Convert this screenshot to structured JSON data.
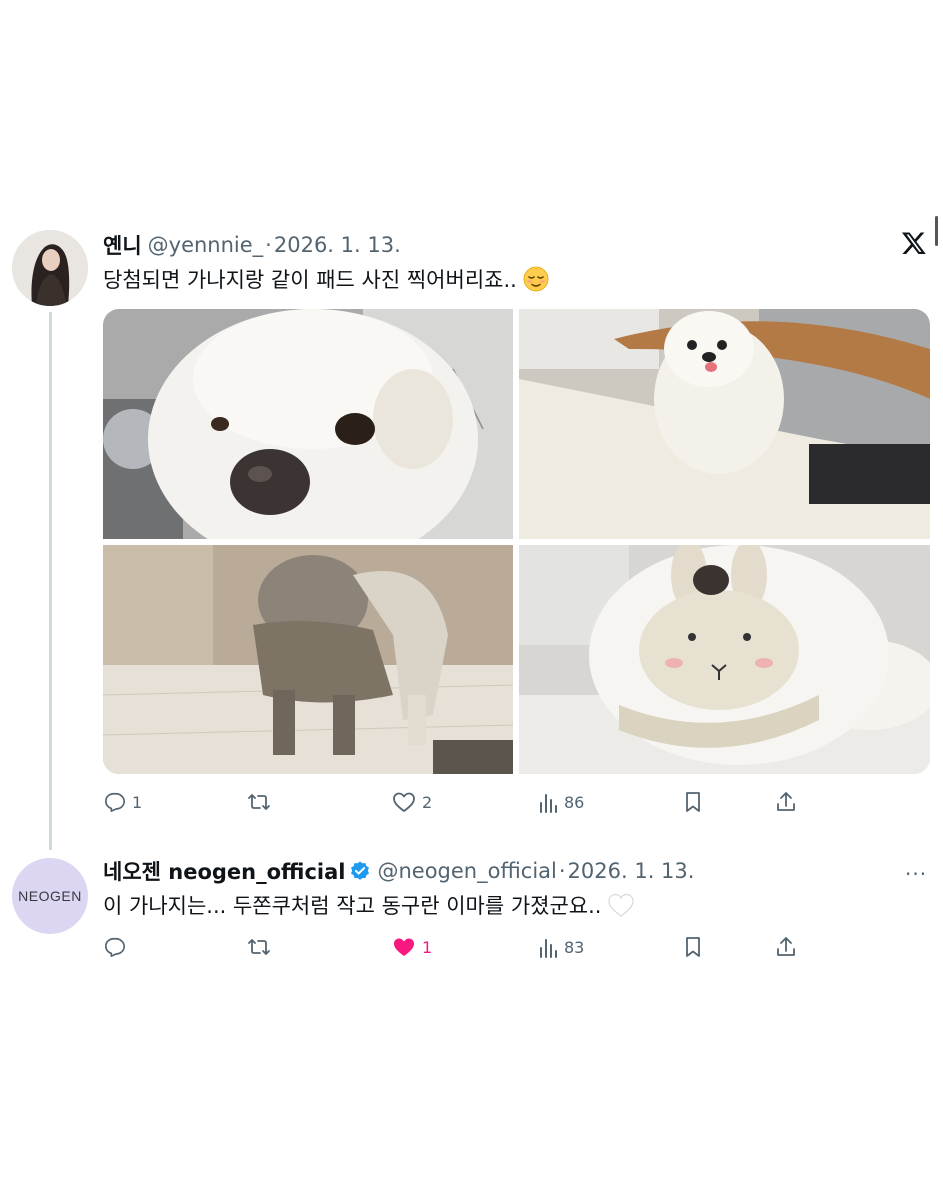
{
  "tweet1": {
    "author_name": "옌니",
    "handle": "@yennnie_",
    "separator": "·",
    "date": "2026. 1. 13.",
    "text": "당첨되면 가나지랑 같이 패드 사진 찍어버리죠..",
    "emoji": "relieved-face",
    "photos": [
      "dog-closeup-nose",
      "dog-at-table",
      "dog-in-sweater-dark",
      "dog-with-bunny-plush"
    ],
    "actions": {
      "reply_count": "1",
      "retweet_count": "",
      "like_count": "2",
      "view_count": "86"
    }
  },
  "tweet2": {
    "author_name": "네오젠 neogen_official",
    "verified": true,
    "handle": "@neogen_official",
    "separator": "·",
    "date": "2026. 1. 13.",
    "text": "이 가나지는... 두쫀쿠처럼 작고 동구란 이마를 가졌군요..",
    "emoji": "white-heart",
    "avatar_text": "NEOGEN",
    "actions": {
      "reply_count": "",
      "retweet_count": "",
      "like_count": "1",
      "liked": true,
      "view_count": "83"
    }
  },
  "colors": {
    "text_primary": "#0f1419",
    "text_secondary": "#536471",
    "like_active": "#f91880",
    "verified_blue": "#1d9bf0",
    "neogen_avatar_bg": "#dcd6f2"
  }
}
